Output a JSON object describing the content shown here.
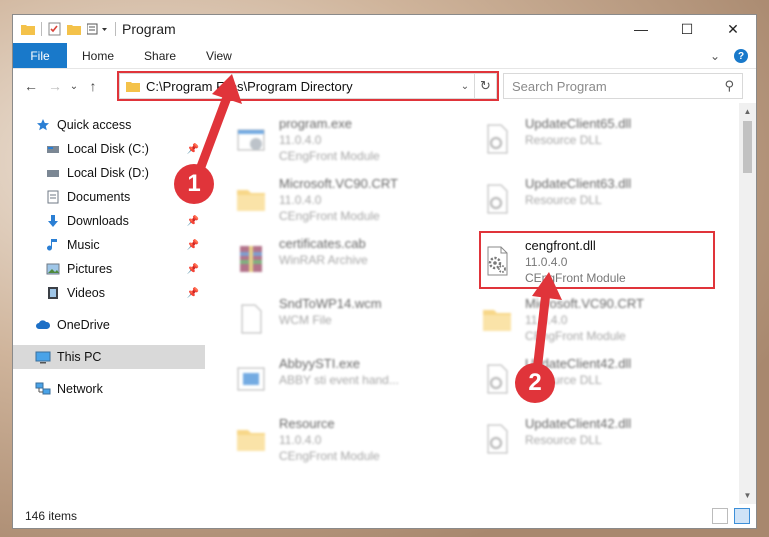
{
  "window": {
    "title": "Program",
    "controls": {
      "minimize": "—",
      "maximize": "☐",
      "close": "✕"
    }
  },
  "ribbon": {
    "tabs": [
      "File",
      "Home",
      "Share",
      "View"
    ],
    "expand": "⌄",
    "help": "?"
  },
  "nav": {
    "back": "←",
    "forward": "→",
    "recent": "⌄",
    "up": "↑",
    "address": "C:\\Program Files\\Program Directory",
    "address_dropdown": "⌄",
    "refresh": "↻",
    "search_placeholder": "Search Program",
    "search_icon": "⚲"
  },
  "sidebar": {
    "items": [
      {
        "label": "Quick access",
        "icon": "star-icon",
        "pinned": false
      },
      {
        "label": "Local Disk (C:)",
        "icon": "drive-icon",
        "pinned": true
      },
      {
        "label": "Local Disk (D:)",
        "icon": "drive-icon",
        "pinned": true
      },
      {
        "label": "Documents",
        "icon": "document-icon",
        "pinned": true
      },
      {
        "label": "Downloads",
        "icon": "download-icon",
        "pinned": true
      },
      {
        "label": "Music",
        "icon": "music-icon",
        "pinned": true
      },
      {
        "label": "Pictures",
        "icon": "picture-icon",
        "pinned": true
      },
      {
        "label": "Videos",
        "icon": "video-icon",
        "pinned": true
      },
      {
        "label": "OneDrive",
        "icon": "cloud-icon"
      },
      {
        "label": "This PC",
        "icon": "computer-icon"
      },
      {
        "label": "Network",
        "icon": "network-icon"
      }
    ],
    "pin_glyph": "📌"
  },
  "files": [
    {
      "name": "program.exe",
      "line2": "11.0.4.0",
      "line3": "CEngFront Module",
      "icon": "exe-icon"
    },
    {
      "name": "UpdateClient65.dll",
      "line2": "Resource DLL",
      "line3": "",
      "icon": "dll-icon"
    },
    {
      "name": "Microsoft.VC90.CRT",
      "line2": "11.0.4.0",
      "line3": "CEngFront Module",
      "icon": "folder-icon"
    },
    {
      "name": "UpdateClient63.dll",
      "line2": "Resource DLL",
      "line3": "",
      "icon": "dll-icon"
    },
    {
      "name": "certificates.cab",
      "line2": "WinRAR Archive",
      "line3": "",
      "icon": "archive-icon"
    },
    {
      "name": "cengfront.dll",
      "line2": "11.0.4.0",
      "line3": "CEngFront Module",
      "icon": "dll-icon"
    },
    {
      "name": "SndToWP14.wcm",
      "line2": "WCM File",
      "line3": "",
      "icon": "file-icon"
    },
    {
      "name": "Microsoft.VC90.CRT",
      "line2": "11.0.4.0",
      "line3": "CEngFront Module",
      "icon": "folder-icon"
    },
    {
      "name": "AbbyySTI.exe",
      "line2": "ABBY sti event hand...",
      "line3": "",
      "icon": "exe-icon"
    },
    {
      "name": "UpdateClient42.dll",
      "line2": "Resource DLL",
      "line3": "",
      "icon": "dll-icon"
    },
    {
      "name": "Resource",
      "line2": "11.0.4.0",
      "line3": "CEngFront Module",
      "icon": "folder-icon"
    },
    {
      "name": "UpdateClient42.dll",
      "line2": "Resource DLL",
      "line3": "",
      "icon": "dll-icon"
    }
  ],
  "status": {
    "items_count": "146 items"
  },
  "markers": {
    "one": "1",
    "two": "2"
  },
  "colors": {
    "accent": "#1979ca",
    "annotation": "#e0343a"
  }
}
